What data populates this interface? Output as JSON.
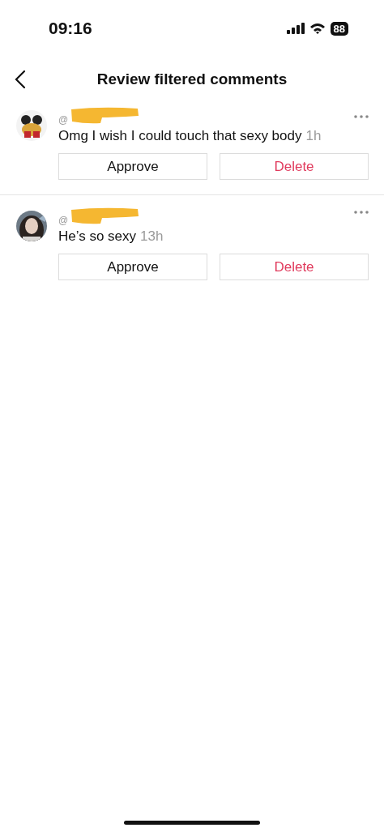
{
  "status_bar": {
    "time": "09:16",
    "battery": "88"
  },
  "header": {
    "title": "Review filtered comments"
  },
  "comments": [
    {
      "username": "@",
      "text": "Omg I wish I could touch that sexy body",
      "time": "1h",
      "redacted": true,
      "actions": [
        "Approve",
        "Delete"
      ]
    },
    {
      "username": "@",
      "text": "He’s so sexy",
      "time": "13h",
      "redacted": true,
      "actions": [
        "Approve",
        "Delete"
      ]
    }
  ]
}
